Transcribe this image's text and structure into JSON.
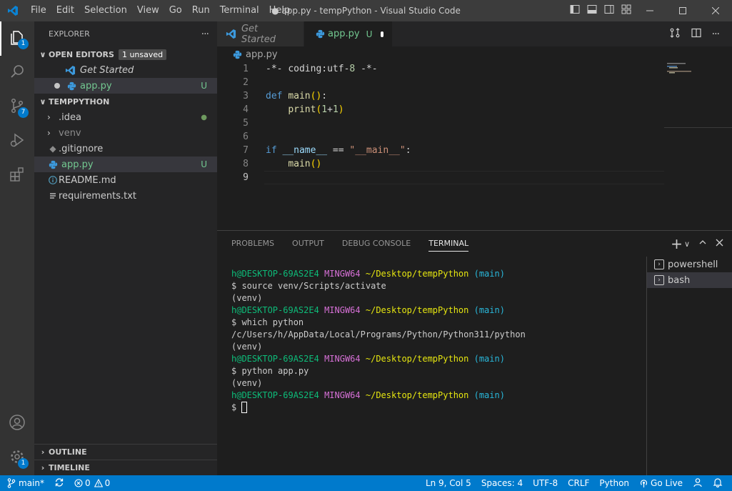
{
  "window": {
    "title": "● app.py - tempPython - Visual Studio Code"
  },
  "menu": [
    "File",
    "Edit",
    "Selection",
    "View",
    "Go",
    "Run",
    "Terminal",
    "Help"
  ],
  "activity": {
    "explorer_badge": "1",
    "source_control_badge": "7",
    "settings_badge": "1"
  },
  "explorer": {
    "header": "EXPLORER",
    "more": "···",
    "open_editors": {
      "title": "OPEN EDITORS",
      "badge": "1 unsaved",
      "items": [
        {
          "label": "Get Started",
          "status": ""
        },
        {
          "label": "app.py",
          "status": "U"
        }
      ]
    },
    "folder": {
      "title": "TEMPPYTHON",
      "items": [
        {
          "label": ".idea",
          "status": "●"
        },
        {
          "label": "venv",
          "status": ""
        },
        {
          "label": ".gitignore",
          "status": ""
        },
        {
          "label": "app.py",
          "status": "U"
        },
        {
          "label": "README.md",
          "status": ""
        },
        {
          "label": "requirements.txt",
          "status": ""
        }
      ]
    },
    "outline": "OUTLINE",
    "timeline": "TIMELINE"
  },
  "tabs": [
    {
      "label": "Get Started"
    },
    {
      "label": "app.py",
      "status": "U"
    }
  ],
  "breadcrumb": "app.py",
  "editor": {
    "line_numbers": [
      "1",
      "2",
      "3",
      "4",
      "5",
      "6",
      "7",
      "8",
      "9"
    ],
    "current_line": 9,
    "lines": [
      "-*- coding:utf-8 -*-",
      "",
      "def main():",
      "    print(1+1)",
      "",
      "",
      "if __name__ == \"__main__\":",
      "    main()",
      ""
    ]
  },
  "panel": {
    "tabs": [
      "PROBLEMS",
      "OUTPUT",
      "DEBUG CONSOLE",
      "TERMINAL"
    ],
    "active_tab": "TERMINAL",
    "terminal": {
      "user_host": "h@DESKTOP-69AS2E4",
      "env": "MINGW64",
      "path": "~/Desktop/tempPython",
      "branch": "(main)",
      "commands": [
        "$ source venv/Scripts/activate",
        "(venv)",
        "$ which python",
        "/c/Users/h/AppData/Local/Programs/Python/Python311/python",
        "(venv)",
        "$ python app.py",
        "(venv)",
        "$ "
      ]
    },
    "terminals": [
      "powershell",
      "bash"
    ]
  },
  "status": {
    "branch": "main*",
    "errors": "0",
    "warnings": "0",
    "position": "Ln 9, Col 5",
    "spaces": "Spaces: 4",
    "encoding": "UTF-8",
    "eol": "CRLF",
    "language": "Python",
    "golive": "Go Live"
  },
  "colors": {
    "accent": "#007acc",
    "untracked": "#73c991",
    "titlebar": "#3c3c3c"
  }
}
